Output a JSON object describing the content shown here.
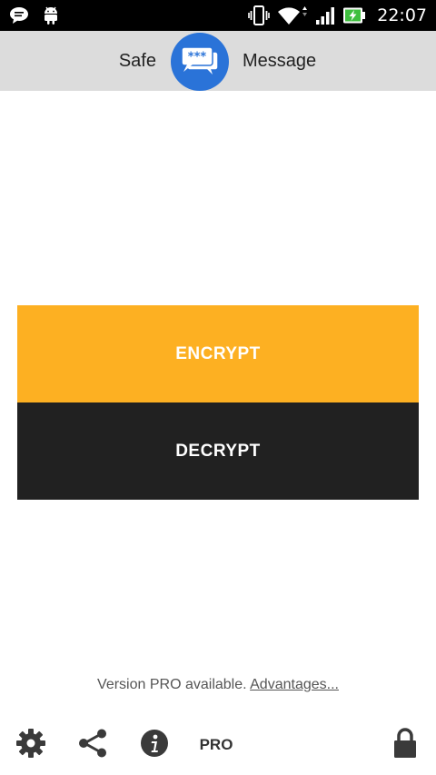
{
  "status_bar": {
    "time": "22:07",
    "icons": [
      "message-icon",
      "android-icon",
      "vibrate-icon",
      "wifi-icon",
      "signal-icon",
      "battery-charging-icon"
    ]
  },
  "header": {
    "left_title": "Safe",
    "right_title": "Message",
    "logo_icon": "chat-bubbles-icon",
    "logo_text": "***"
  },
  "actions": {
    "encrypt_label": "ENCRYPT",
    "decrypt_label": "DECRYPT"
  },
  "pro_notice": {
    "text": "Version PRO available.",
    "link": "Advantages..."
  },
  "toolbar": {
    "pro_label": "PRO",
    "icons": [
      "gear-icon",
      "share-icon",
      "info-icon",
      "lock-icon"
    ]
  },
  "colors": {
    "encrypt": "#fdb022",
    "decrypt": "#212121",
    "header": "#dcdcdc",
    "logo": "#2a73d8"
  }
}
